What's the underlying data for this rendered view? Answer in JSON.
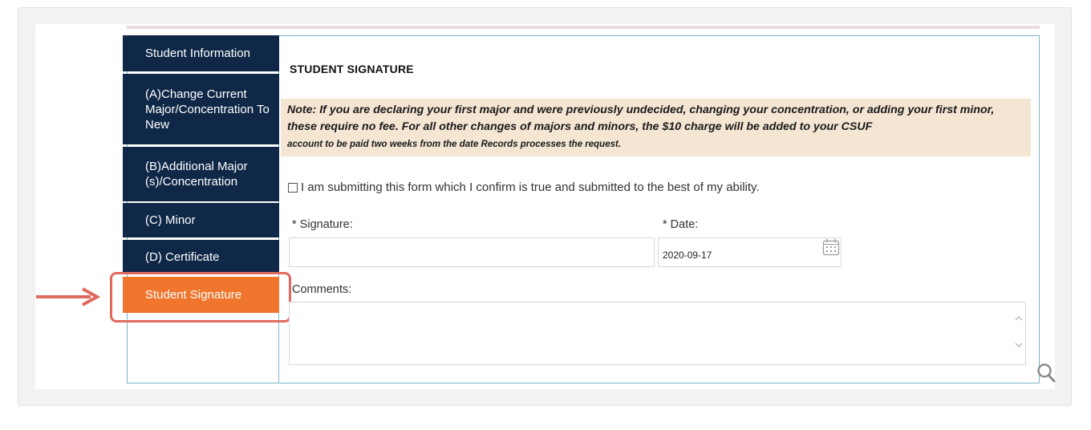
{
  "nav": {
    "items": [
      {
        "label": "Student Information"
      },
      {
        "label": "(A)Change Current Major/Concentration To New"
      },
      {
        "label": "(B)Additional Major (s)/Concentration"
      },
      {
        "label": "(C) Minor"
      },
      {
        "label": "(D) Certificate"
      },
      {
        "label": "Student Signature"
      }
    ],
    "active_index": 5
  },
  "section": {
    "title": "STUDENT SIGNATURE",
    "note_main": "Note: If you are declaring your first major and were previously undecided, changing your concentration, or adding your first minor, these require no fee. For all other changes of majors and minors, the $10 charge will be added to your CSUF",
    "note_small": "account to be paid two weeks from the date Records processes the request."
  },
  "form": {
    "confirm_label": "I am submitting this form which I confirm is true and submitted to the best of my ability.",
    "confirm_checked": false,
    "signature_label": "* Signature:",
    "signature_value": "",
    "date_label": "* Date:",
    "date_value": "2020-09-17",
    "comments_label": "Comments:",
    "comments_value": ""
  },
  "colors": {
    "nav_bg": "#0f2847",
    "nav_active": "#f0762d",
    "note_bg": "#f5e6d4",
    "annotation": "#e06a5e",
    "frame": "#7ab8c6"
  },
  "icons": [
    "calendar-icon",
    "search-icon",
    "annotation-arrow-icon",
    "scroll-up-icon",
    "scroll-down-icon"
  ]
}
